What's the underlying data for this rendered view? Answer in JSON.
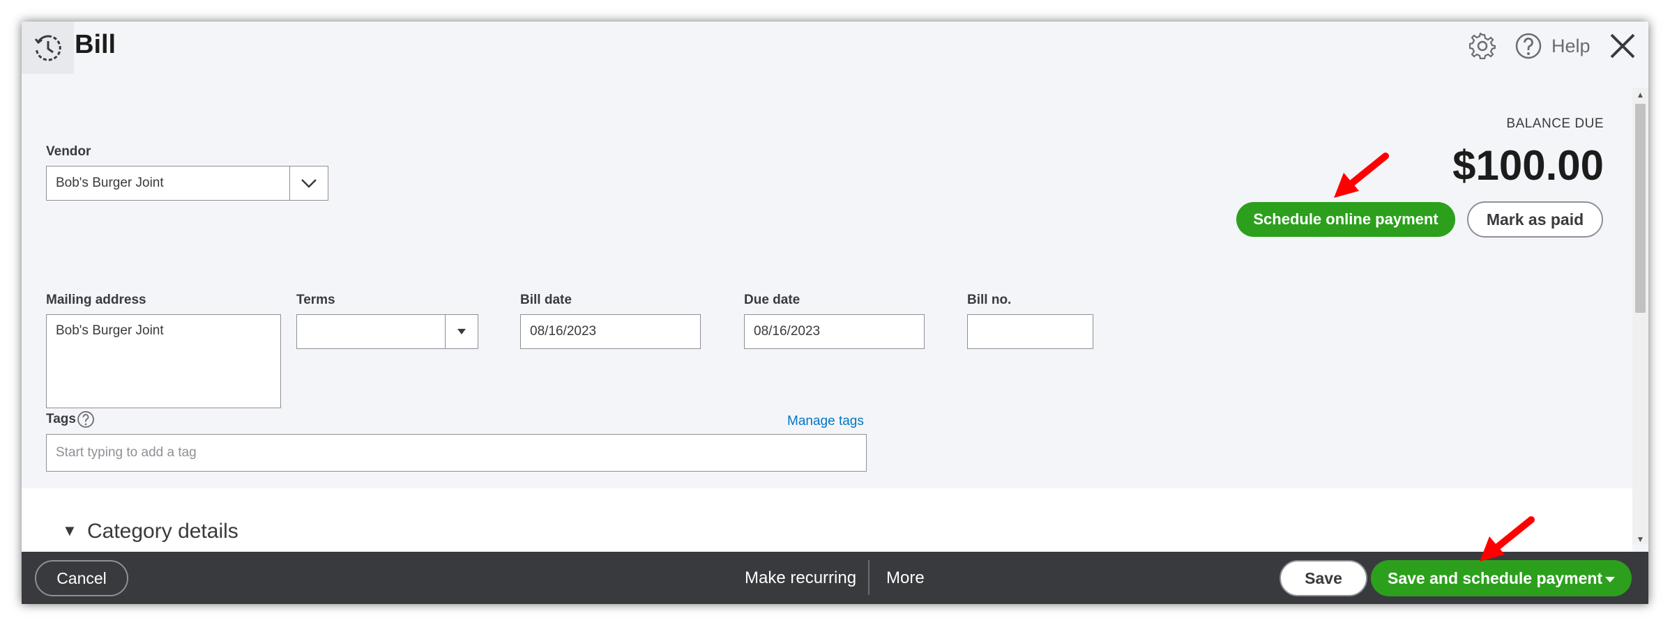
{
  "window": {
    "title": "Bill"
  },
  "header": {
    "help_label": "Help"
  },
  "vendor": {
    "label": "Vendor",
    "value": "Bob's Burger Joint"
  },
  "balance": {
    "label": "BALANCE DUE",
    "amount": "$100.00"
  },
  "actions": {
    "schedule_online": "Schedule online payment",
    "mark_paid": "Mark as paid"
  },
  "mailing": {
    "label": "Mailing address",
    "value": "Bob's Burger Joint"
  },
  "terms": {
    "label": "Terms",
    "value": ""
  },
  "bill_date": {
    "label": "Bill date",
    "value": "08/16/2023"
  },
  "due_date": {
    "label": "Due date",
    "value": "08/16/2023"
  },
  "bill_no": {
    "label": "Bill no.",
    "value": ""
  },
  "tags": {
    "label": "Tags",
    "manage": "Manage tags",
    "placeholder": "Start typing to add a tag"
  },
  "category": {
    "title": "Category details"
  },
  "footer": {
    "cancel": "Cancel",
    "make_recurring": "Make recurring",
    "more": "More",
    "save": "Save",
    "save_schedule": "Save and schedule payment"
  },
  "colors": {
    "brand_green": "#2ca01c",
    "footer_bg": "#393a3d",
    "link": "#0077c5",
    "annotation": "#ff0000"
  }
}
